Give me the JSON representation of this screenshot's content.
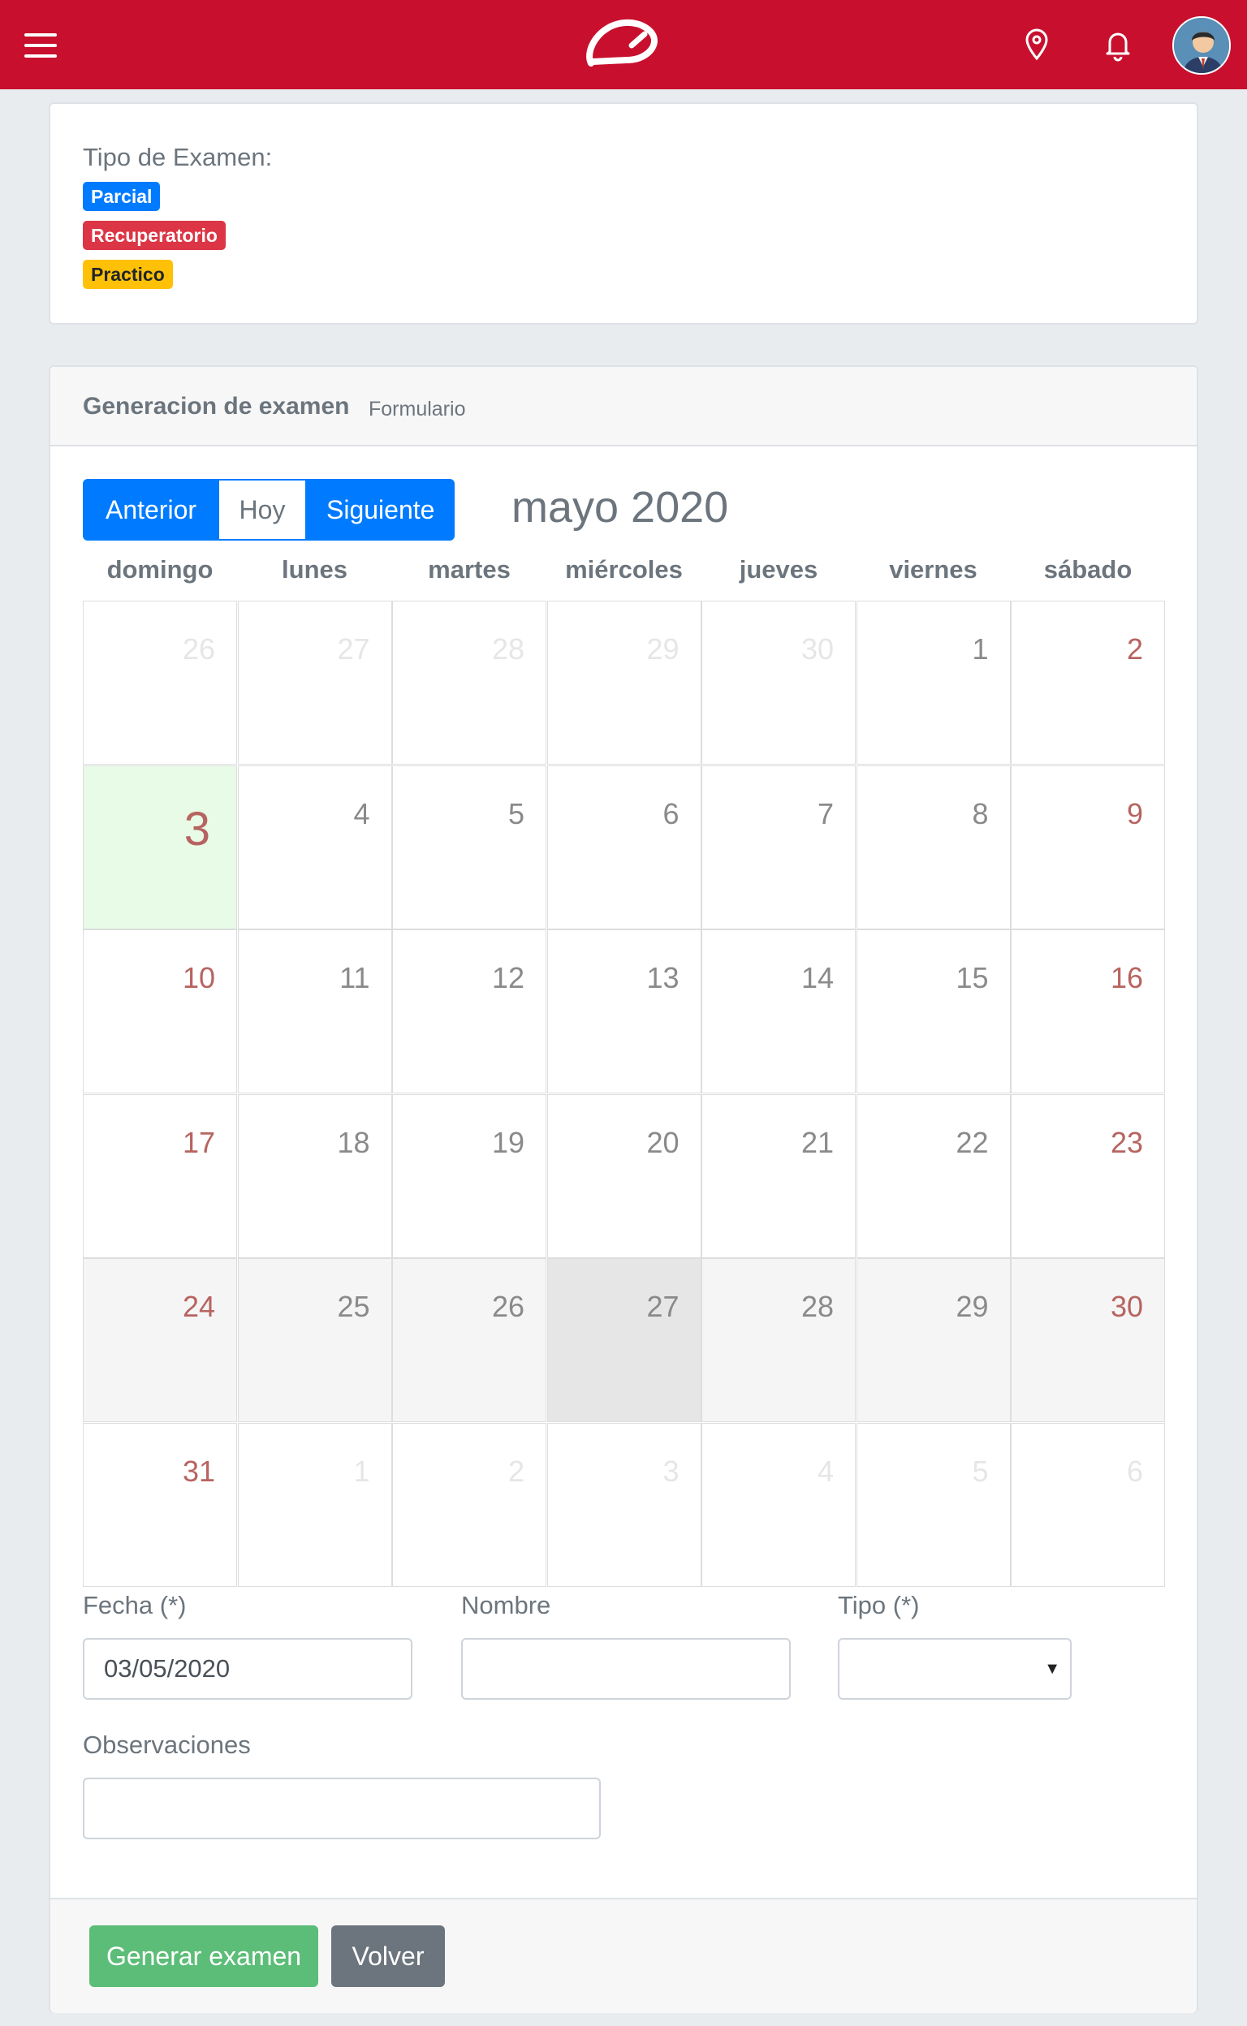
{
  "topbar": {
    "menu_icon": "hamburger-menu-icon",
    "logo": "app-logo",
    "location_icon": "map-pin-icon",
    "notification_icon": "bell-icon",
    "avatar": "user-avatar",
    "brand_color": "#c8102e"
  },
  "legend": {
    "title": "Tipo de Examen:",
    "badges": [
      {
        "label": "Parcial",
        "color": "#007bff"
      },
      {
        "label": "Recuperatorio",
        "color": "#dc3545"
      },
      {
        "label": "Practico",
        "color": "#ffc107"
      }
    ]
  },
  "form_card": {
    "title": "Generacion de examen",
    "subtitle": "Formulario"
  },
  "calendar": {
    "prev_label": "Anterior",
    "today_label": "Hoy",
    "next_label": "Siguiente",
    "month_title": "mayo 2020",
    "weekdays": [
      "domingo",
      "lunes",
      "martes",
      "miércoles",
      "jueves",
      "viernes",
      "sábado"
    ],
    "weeks": [
      [
        {
          "d": "26",
          "t": "other"
        },
        {
          "d": "27",
          "t": "other"
        },
        {
          "d": "28",
          "t": "other"
        },
        {
          "d": "29",
          "t": "other"
        },
        {
          "d": "30",
          "t": "other"
        },
        {
          "d": "1",
          "t": "day"
        },
        {
          "d": "2",
          "t": "weekend"
        }
      ],
      [
        {
          "d": "3",
          "t": "today"
        },
        {
          "d": "4",
          "t": "day"
        },
        {
          "d": "5",
          "t": "day"
        },
        {
          "d": "6",
          "t": "day"
        },
        {
          "d": "7",
          "t": "day"
        },
        {
          "d": "8",
          "t": "day"
        },
        {
          "d": "9",
          "t": "weekend"
        }
      ],
      [
        {
          "d": "10",
          "t": "weekend"
        },
        {
          "d": "11",
          "t": "day"
        },
        {
          "d": "12",
          "t": "day"
        },
        {
          "d": "13",
          "t": "day"
        },
        {
          "d": "14",
          "t": "day"
        },
        {
          "d": "15",
          "t": "day"
        },
        {
          "d": "16",
          "t": "weekend"
        }
      ],
      [
        {
          "d": "17",
          "t": "weekend"
        },
        {
          "d": "18",
          "t": "day"
        },
        {
          "d": "19",
          "t": "day"
        },
        {
          "d": "20",
          "t": "day"
        },
        {
          "d": "21",
          "t": "day"
        },
        {
          "d": "22",
          "t": "day"
        },
        {
          "d": "23",
          "t": "weekend"
        }
      ],
      [
        {
          "d": "24",
          "t": "weekend-shade"
        },
        {
          "d": "25",
          "t": "shade"
        },
        {
          "d": "26",
          "t": "shade"
        },
        {
          "d": "27",
          "t": "selected"
        },
        {
          "d": "28",
          "t": "shade"
        },
        {
          "d": "29",
          "t": "shade"
        },
        {
          "d": "30",
          "t": "weekend-shade"
        }
      ],
      [
        {
          "d": "31",
          "t": "weekend"
        },
        {
          "d": "1",
          "t": "other"
        },
        {
          "d": "2",
          "t": "other"
        },
        {
          "d": "3",
          "t": "other"
        },
        {
          "d": "4",
          "t": "other"
        },
        {
          "d": "5",
          "t": "other"
        },
        {
          "d": "6",
          "t": "other"
        }
      ]
    ]
  },
  "form": {
    "fecha_label": "Fecha (*)",
    "fecha_value": "03/05/2020",
    "nombre_label": "Nombre",
    "nombre_value": "",
    "tipo_label": "Tipo (*)",
    "tipo_value": "",
    "observaciones_label": "Observaciones",
    "observaciones_value": ""
  },
  "footer": {
    "generate_label": "Generar examen",
    "back_label": "Volver"
  }
}
